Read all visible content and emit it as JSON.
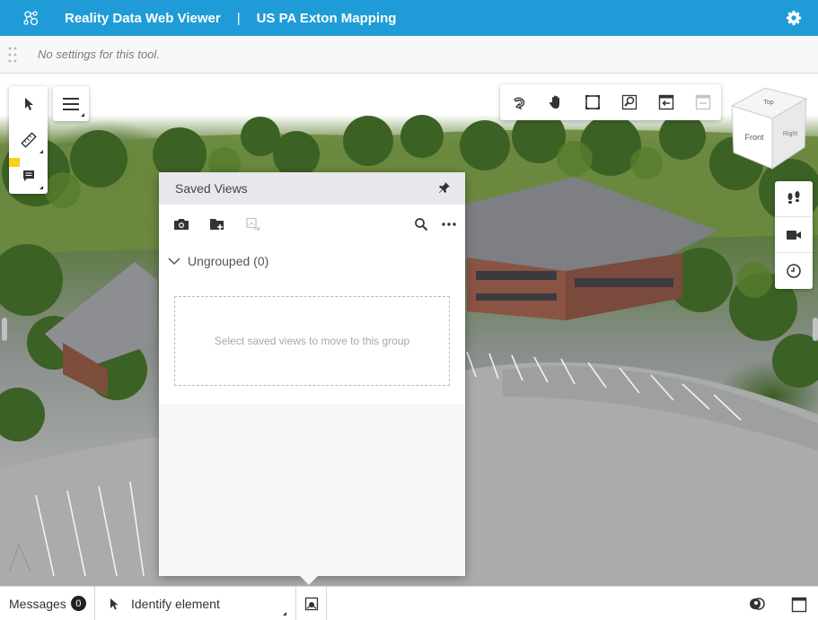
{
  "header": {
    "app_title": "Reality Data Web Viewer",
    "separator": "|",
    "project_name": "US PA Exton Mapping",
    "icons": [
      "app-logo-icon",
      "gear-icon"
    ]
  },
  "tool_settings": {
    "message": "No settings for this tool."
  },
  "left_toolbar": {
    "items": [
      "select-icon",
      "measure-icon",
      "markup-icon"
    ]
  },
  "navigation_toolbar": {
    "items": [
      "rotate-icon",
      "pan-icon",
      "fit-view-icon",
      "window-area-icon",
      "previous-view-icon",
      "next-view-icon"
    ]
  },
  "view_cube": {
    "faces": [
      "Top",
      "Front",
      "Right"
    ]
  },
  "right_toolbar": {
    "items": [
      "walk-icon",
      "camera-icon",
      "clock-icon"
    ]
  },
  "saved_views_panel": {
    "title": "Saved Views",
    "group_label": "Ungrouped (0)",
    "empty_message": "Select saved views to move to this group"
  },
  "status_bar": {
    "messages_label": "Messages",
    "messages_count": "0",
    "identify_label": "Identify element"
  },
  "colors": {
    "header_bg": "#1f9cd7",
    "accent_yellow": "#f7d118"
  }
}
